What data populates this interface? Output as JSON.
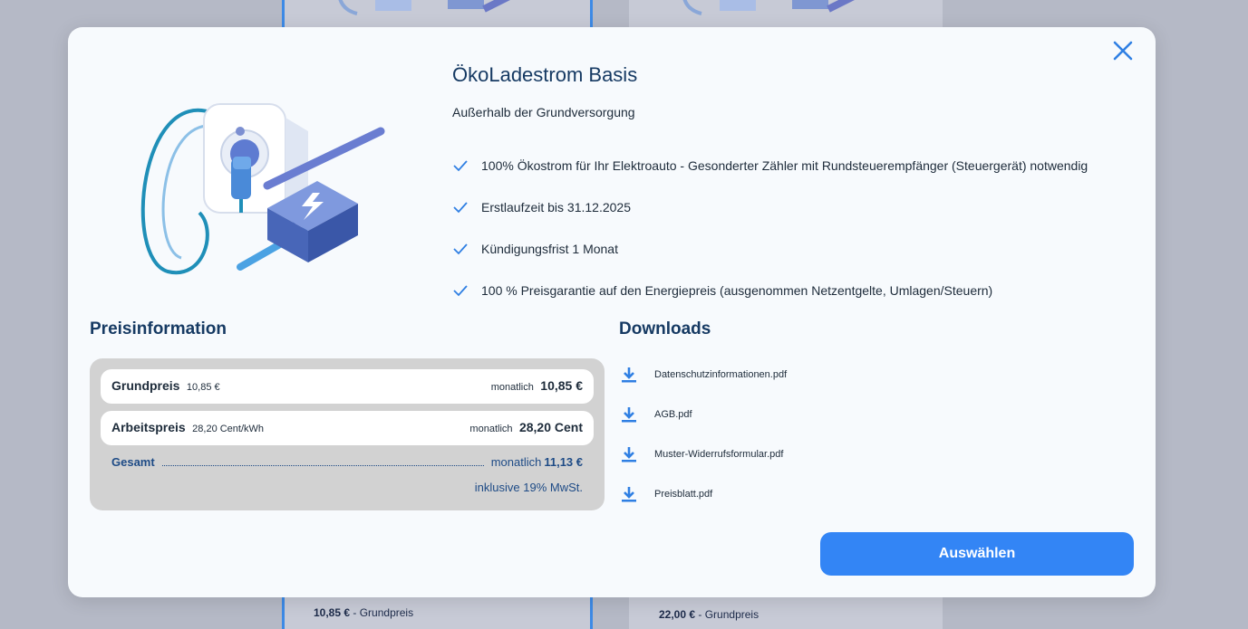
{
  "background": {
    "left_card_price": {
      "value": "10,85 €",
      "label": "- Grundpreis"
    },
    "right_card_price": {
      "value": "22,00 €",
      "label": "- Grundpreis"
    }
  },
  "modal": {
    "title": "ÖkoLadestrom Basis",
    "subtitle": "Außerhalb der Grundversorgung",
    "features": [
      "100% Ökostrom für Ihr Elektroauto - Gesonderter Zähler mit Rundsteuerempfänger (Steuergerät) notwendig",
      "Erstlaufzeit bis 31.12.2025",
      "Kündigungsfrist 1 Monat",
      "100 % Preisgarantie auf den Energiepreis (ausgenommen Netzentgelte, Umlagen/Steuern)"
    ],
    "price_info": {
      "title": "Preisinformation",
      "rows": [
        {
          "label": "Grundpreis",
          "detail": "10,85 €",
          "period": "monatlich",
          "value": "10,85 €"
        },
        {
          "label": "Arbeitspreis",
          "detail": "28,20 Cent/kWh",
          "period": "monatlich",
          "value": "28,20 Cent"
        }
      ],
      "total": {
        "label": "Gesamt",
        "period": "monatlich",
        "value": "11,13 €"
      },
      "vat_note": "inklusive 19% MwSt."
    },
    "downloads": {
      "title": "Downloads",
      "items": [
        "Datenschutzinformationen.pdf",
        "AGB.pdf",
        "Muster-Widerrufsformular.pdf",
        "Preisblatt.pdf"
      ]
    },
    "select_label": "Auswählen",
    "colors": {
      "accent": "#3385f5",
      "heading": "#163a63",
      "total": "#1e4b86"
    }
  }
}
